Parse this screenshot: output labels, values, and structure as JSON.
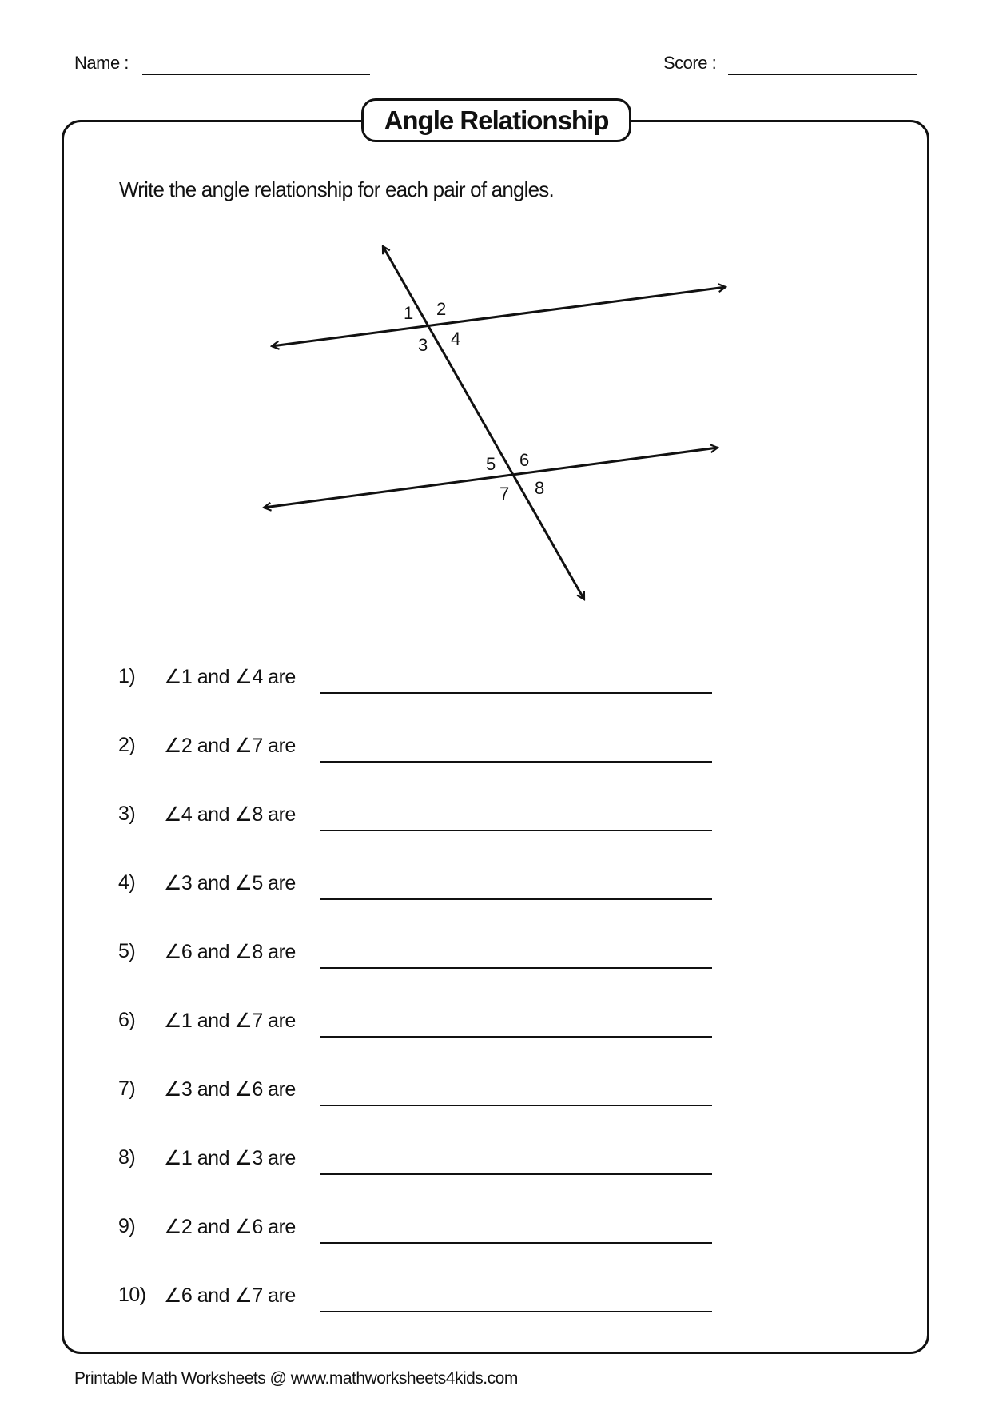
{
  "header": {
    "name_label": "Name :",
    "score_label": "Score :"
  },
  "title": "Angle Relationship",
  "instructions": "Write the angle relationship for each pair of angles.",
  "diagram": {
    "description": "Two lines cut by a transversal",
    "angle_labels": [
      "1",
      "2",
      "3",
      "4",
      "5",
      "6",
      "7",
      "8"
    ]
  },
  "questions": [
    {
      "number": "1)",
      "text": "∠1 and ∠4 are",
      "answer": ""
    },
    {
      "number": "2)",
      "text": "∠2 and ∠7 are",
      "answer": ""
    },
    {
      "number": "3)",
      "text": "∠4 and ∠8 are",
      "answer": ""
    },
    {
      "number": "4)",
      "text": "∠3 and ∠5 are",
      "answer": ""
    },
    {
      "number": "5)",
      "text": "∠6 and ∠8 are",
      "answer": ""
    },
    {
      "number": "6)",
      "text": "∠1 and ∠7 are",
      "answer": ""
    },
    {
      "number": "7)",
      "text": "∠3 and ∠6 are",
      "answer": ""
    },
    {
      "number": "8)",
      "text": "∠1 and ∠3 are",
      "answer": ""
    },
    {
      "number": "9)",
      "text": "∠2 and ∠6 are",
      "answer": ""
    },
    {
      "number": "10)",
      "text": "∠6 and ∠7 are",
      "answer": ""
    }
  ],
  "footer": "Printable Math Worksheets @ www.mathworksheets4kids.com"
}
